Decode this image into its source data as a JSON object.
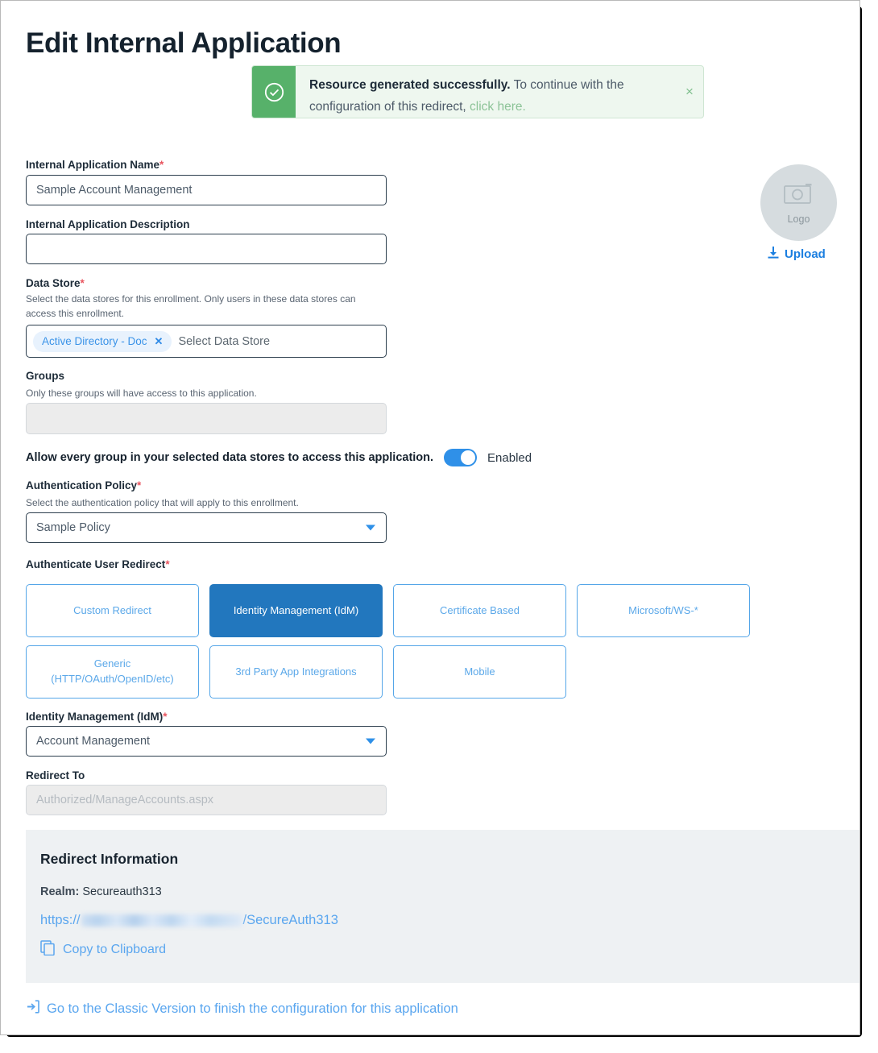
{
  "page": {
    "title": "Edit Internal Application"
  },
  "alert": {
    "icon": "check-circle-icon",
    "strong": "Resource generated successfully.",
    "text": " To continue with the configuration of this redirect, ",
    "link": "click here.",
    "close": "×",
    "bar_color": "#57b16a",
    "bg_color": "#eef7ef"
  },
  "logo": {
    "icon": "camera-icon",
    "caption": "Logo",
    "upload_icon": "download-icon",
    "upload_label": "Upload"
  },
  "form": {
    "app_name": {
      "label": "Internal Application Name",
      "required": "*",
      "value": "Sample Account Management",
      "placeholder": ""
    },
    "app_description": {
      "label": "Internal Application Description",
      "required": "",
      "value": "",
      "placeholder": ""
    },
    "data_store": {
      "label": "Data Store",
      "required": "*",
      "help": "Select the data stores for this enrollment. Only users in these data stores can access this enrollment.",
      "chips": [
        {
          "label": "Active Directory - Doc",
          "remove": "✕"
        }
      ],
      "placeholder": "Select Data Store"
    },
    "groups": {
      "label": "Groups",
      "required": "",
      "help": "Only these groups will have access to this application.",
      "value": "",
      "placeholder": ""
    },
    "allow_every_group": {
      "label": "Allow every group in your selected data stores to access this application.",
      "state": "Enabled",
      "on": true,
      "accent": "#2f90e8"
    },
    "auth_policy": {
      "label": "Authentication Policy",
      "required": "*",
      "help": "Select the authentication policy that will apply to this enrollment.",
      "value": "Sample Policy"
    },
    "authenticate_user_redirect": {
      "label": "Authenticate User Redirect",
      "required": "*",
      "selected": "Identity Management (IdM)",
      "selected_color": "#2277be",
      "tiles": [
        {
          "label": "Custom Redirect",
          "selected": false
        },
        {
          "label": "Identity Management (IdM)",
          "selected": true
        },
        {
          "label": "Certificate Based",
          "selected": false
        },
        {
          "label": "Microsoft/WS-*",
          "selected": false
        },
        {
          "label": "Generic (HTTP/OAuth/OpenID/etc)",
          "selected": false
        },
        {
          "label": "3rd Party App Integrations",
          "selected": false
        },
        {
          "label": "Mobile",
          "selected": false
        }
      ]
    },
    "idm": {
      "label": "Identity Management (IdM)",
      "required": "*",
      "value": "Account Management"
    },
    "redirect_to": {
      "label": "Redirect To",
      "required": "",
      "value": "",
      "placeholder": "Authorized/ManageAccounts.aspx",
      "disabled": true
    }
  },
  "redirect_info": {
    "title": "Redirect Information",
    "realm_label": "Realm:",
    "realm_value": "Secureauth313",
    "url_prefix": "https://",
    "url_host": "",
    "url_suffix": "/SecureAuth313",
    "copy_icon": "copy-icon",
    "copy_label": "Copy to Clipboard"
  },
  "footer": {
    "icon": "enter-box-icon",
    "label": "Go to the Classic Version to finish the configuration for this application"
  }
}
